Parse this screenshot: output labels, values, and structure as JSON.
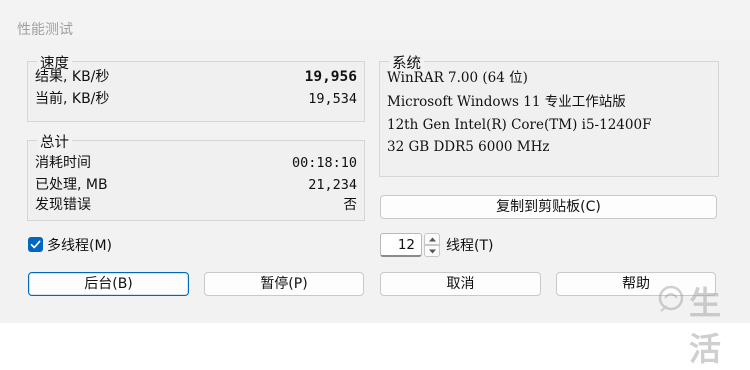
{
  "window": {
    "title": "性能测试"
  },
  "speed": {
    "legend": "速度",
    "rows": [
      {
        "label": "结果, KB/秒",
        "value": "19,956"
      },
      {
        "label": "当前, KB/秒",
        "value": "19,534"
      }
    ]
  },
  "total": {
    "legend": "总计",
    "rows": [
      {
        "label": "消耗时间",
        "value": "00:18:10"
      },
      {
        "label": "已处理, MB",
        "value": "21,234"
      },
      {
        "label": "发现错误",
        "value": "否"
      }
    ]
  },
  "system": {
    "legend": "系统",
    "lines": [
      "WinRAR 7.00 (64 位)",
      "Microsoft Windows 11 专业工作站版",
      "12th Gen Intel(R) Core(TM) i5-12400F",
      "32 GB DDR5 6000 MHz"
    ]
  },
  "copy_button": "复制到剪贴板(C)",
  "multithread": {
    "label": "多线程(M)",
    "checked": true
  },
  "threads": {
    "value": "12",
    "label": "线程(T)"
  },
  "buttons": {
    "background": "后台(B)",
    "pause": "暂停(P)",
    "cancel": "取消",
    "help": "帮助"
  },
  "watermark_text": "生活",
  "colors": {
    "accent": "#0067c0"
  }
}
